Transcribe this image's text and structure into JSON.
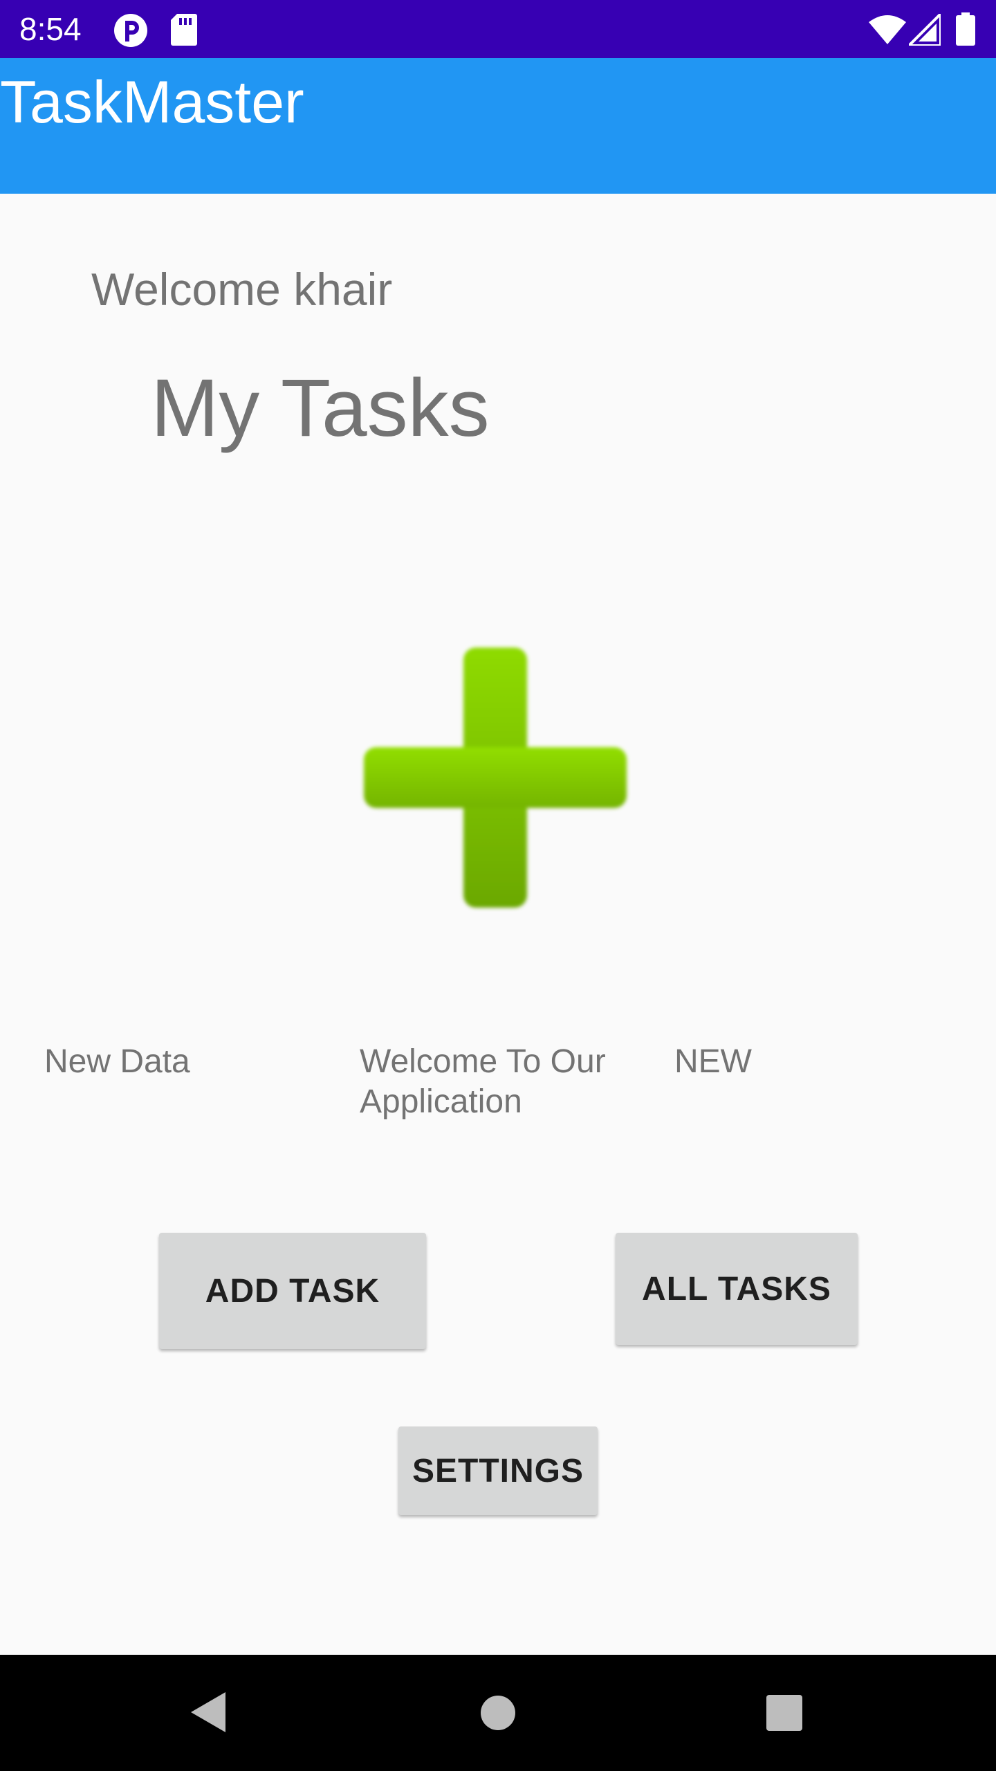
{
  "status_bar": {
    "time": "8:54",
    "icons": [
      "app-notification-icon",
      "sd-card-icon",
      "wifi-icon",
      "signal-icon",
      "battery-icon"
    ]
  },
  "app_bar": {
    "title": "TaskMaster"
  },
  "main": {
    "welcome": "Welcome khair",
    "heading": "My Tasks",
    "plus_icon": "add-plus-icon",
    "labels": {
      "new_data": "New Data",
      "welcome_app": "Welcome To Our Application",
      "new": "NEW"
    },
    "buttons": {
      "add_task": "ADD TASK",
      "all_tasks": "ALL TASKS",
      "settings": "SETTINGS"
    }
  },
  "nav_bar": {
    "icons": [
      "back-icon",
      "home-icon",
      "recents-icon"
    ]
  },
  "colors": {
    "status_bar": "#3700b3",
    "app_bar": "#2196f3",
    "plus_green": "#7cc300",
    "button_bg": "#d6d7d7",
    "text_grey": "#737373"
  }
}
